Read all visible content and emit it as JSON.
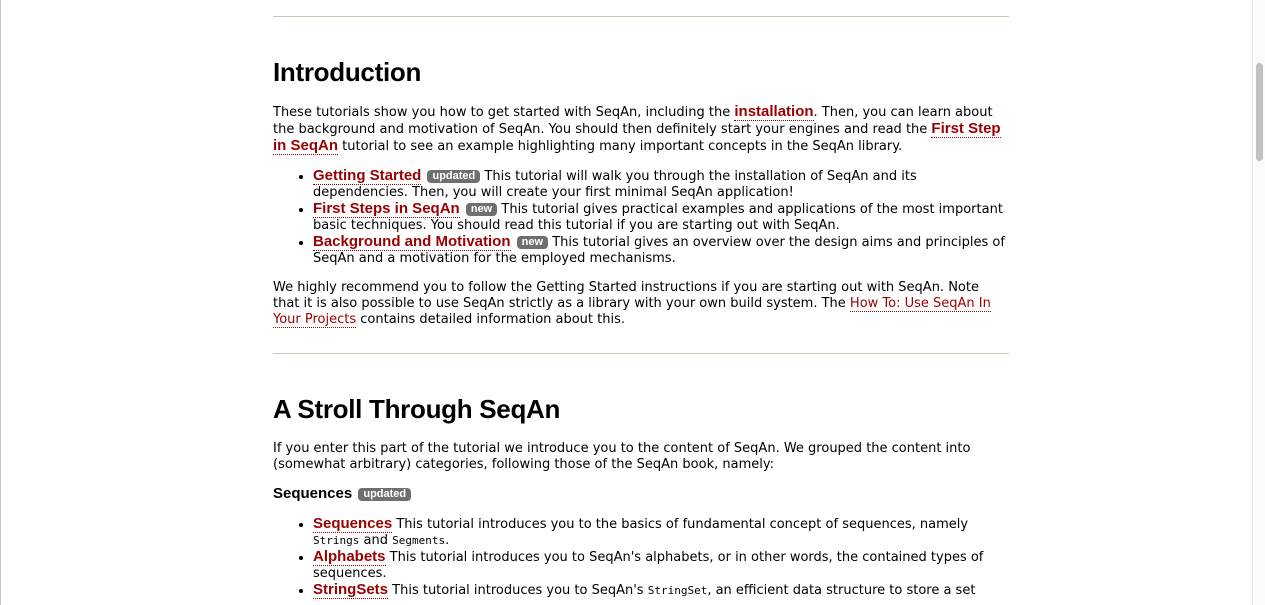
{
  "intro": {
    "heading": "Introduction",
    "para1": {
      "t1": "These tutorials show you how to get started with SeqAn, including the ",
      "link_installation": "installation",
      "t2": ". Then, you can learn about the background and motivation of SeqAn. You should then definitely start your engines and read the ",
      "link_first_step": "First Step in SeqAn",
      "t3": " tutorial to see an example highlighting many important concepts in the SeqAn library."
    },
    "items": [
      {
        "link": "Getting Started",
        "badge": "updated",
        "text": " This tutorial will walk you through the installation of SeqAn and its dependencies. Then, you will create your first minimal SeqAn application!"
      },
      {
        "link": "First Steps in SeqAn",
        "badge": "new",
        "text": " This tutorial gives practical examples and applications of the most important basic techniques. You should read this tutorial if you are starting out with SeqAn."
      },
      {
        "link": "Background and Motivation",
        "badge": "new",
        "text": " This tutorial gives an overview over the design aims and principles of SeqAn and a motivation for the employed mechanisms."
      }
    ],
    "para2": {
      "t1": "We highly recommend you to follow the Getting Started instructions if you are starting out with SeqAn. Note that it is also possible to use SeqAn strictly as a library with your own build system. The ",
      "link_howto": "How To: Use SeqAn In Your Projects",
      "t2": " contains detailed information about this."
    }
  },
  "stroll": {
    "heading": "A Stroll Through SeqAn",
    "para": "If you enter this part of the tutorial we introduce you to the content of SeqAn. We grouped the content into (somewhat arbitrary) categories, following those of the SeqAn book, namely:",
    "subsection": {
      "title": "Sequences",
      "badge": "updated"
    },
    "items": [
      {
        "link": "Sequences",
        "t1": " This tutorial introduces you to the basics of fundamental concept of sequences, namely ",
        "code1": "Strings",
        "t2": " and ",
        "code2": "Segments",
        "t3": "."
      },
      {
        "link": "Alphabets",
        "t1": " This tutorial introduces you to SeqAn's alphabets, or in other words, the contained types of sequences."
      },
      {
        "link": "StringSets",
        "t1": " This tutorial introduces you to SeqAn's ",
        "code1": "StringSet",
        "t2": ", an efficient data structure to store a set"
      }
    ]
  },
  "colors": {
    "link": "#990000",
    "badge_bg": "#6f6f6f",
    "rule": "#c8c6b4"
  }
}
